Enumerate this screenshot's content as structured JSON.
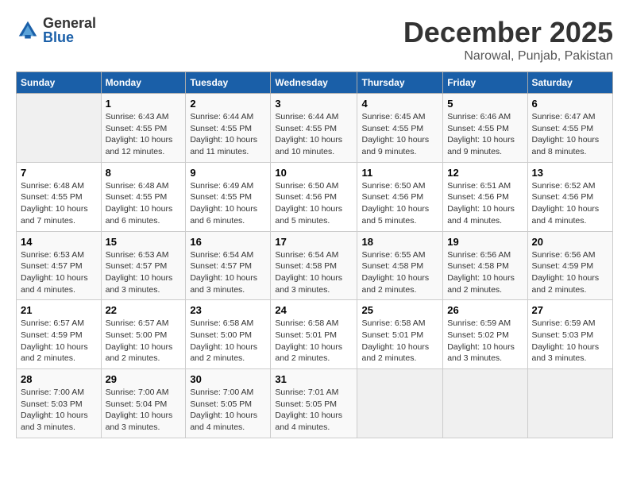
{
  "logo": {
    "general": "General",
    "blue": "Blue"
  },
  "title": "December 2025",
  "subtitle": "Narowal, Punjab, Pakistan",
  "headers": [
    "Sunday",
    "Monday",
    "Tuesday",
    "Wednesday",
    "Thursday",
    "Friday",
    "Saturday"
  ],
  "weeks": [
    [
      {
        "day": "",
        "info": ""
      },
      {
        "day": "1",
        "info": "Sunrise: 6:43 AM\nSunset: 4:55 PM\nDaylight: 10 hours\nand 12 minutes."
      },
      {
        "day": "2",
        "info": "Sunrise: 6:44 AM\nSunset: 4:55 PM\nDaylight: 10 hours\nand 11 minutes."
      },
      {
        "day": "3",
        "info": "Sunrise: 6:44 AM\nSunset: 4:55 PM\nDaylight: 10 hours\nand 10 minutes."
      },
      {
        "day": "4",
        "info": "Sunrise: 6:45 AM\nSunset: 4:55 PM\nDaylight: 10 hours\nand 9 minutes."
      },
      {
        "day": "5",
        "info": "Sunrise: 6:46 AM\nSunset: 4:55 PM\nDaylight: 10 hours\nand 9 minutes."
      },
      {
        "day": "6",
        "info": "Sunrise: 6:47 AM\nSunset: 4:55 PM\nDaylight: 10 hours\nand 8 minutes."
      }
    ],
    [
      {
        "day": "7",
        "info": "Sunrise: 6:48 AM\nSunset: 4:55 PM\nDaylight: 10 hours\nand 7 minutes."
      },
      {
        "day": "8",
        "info": "Sunrise: 6:48 AM\nSunset: 4:55 PM\nDaylight: 10 hours\nand 6 minutes."
      },
      {
        "day": "9",
        "info": "Sunrise: 6:49 AM\nSunset: 4:55 PM\nDaylight: 10 hours\nand 6 minutes."
      },
      {
        "day": "10",
        "info": "Sunrise: 6:50 AM\nSunset: 4:56 PM\nDaylight: 10 hours\nand 5 minutes."
      },
      {
        "day": "11",
        "info": "Sunrise: 6:50 AM\nSunset: 4:56 PM\nDaylight: 10 hours\nand 5 minutes."
      },
      {
        "day": "12",
        "info": "Sunrise: 6:51 AM\nSunset: 4:56 PM\nDaylight: 10 hours\nand 4 minutes."
      },
      {
        "day": "13",
        "info": "Sunrise: 6:52 AM\nSunset: 4:56 PM\nDaylight: 10 hours\nand 4 minutes."
      }
    ],
    [
      {
        "day": "14",
        "info": "Sunrise: 6:53 AM\nSunset: 4:57 PM\nDaylight: 10 hours\nand 4 minutes."
      },
      {
        "day": "15",
        "info": "Sunrise: 6:53 AM\nSunset: 4:57 PM\nDaylight: 10 hours\nand 3 minutes."
      },
      {
        "day": "16",
        "info": "Sunrise: 6:54 AM\nSunset: 4:57 PM\nDaylight: 10 hours\nand 3 minutes."
      },
      {
        "day": "17",
        "info": "Sunrise: 6:54 AM\nSunset: 4:58 PM\nDaylight: 10 hours\nand 3 minutes."
      },
      {
        "day": "18",
        "info": "Sunrise: 6:55 AM\nSunset: 4:58 PM\nDaylight: 10 hours\nand 2 minutes."
      },
      {
        "day": "19",
        "info": "Sunrise: 6:56 AM\nSunset: 4:58 PM\nDaylight: 10 hours\nand 2 minutes."
      },
      {
        "day": "20",
        "info": "Sunrise: 6:56 AM\nSunset: 4:59 PM\nDaylight: 10 hours\nand 2 minutes."
      }
    ],
    [
      {
        "day": "21",
        "info": "Sunrise: 6:57 AM\nSunset: 4:59 PM\nDaylight: 10 hours\nand 2 minutes."
      },
      {
        "day": "22",
        "info": "Sunrise: 6:57 AM\nSunset: 5:00 PM\nDaylight: 10 hours\nand 2 minutes."
      },
      {
        "day": "23",
        "info": "Sunrise: 6:58 AM\nSunset: 5:00 PM\nDaylight: 10 hours\nand 2 minutes."
      },
      {
        "day": "24",
        "info": "Sunrise: 6:58 AM\nSunset: 5:01 PM\nDaylight: 10 hours\nand 2 minutes."
      },
      {
        "day": "25",
        "info": "Sunrise: 6:58 AM\nSunset: 5:01 PM\nDaylight: 10 hours\nand 2 minutes."
      },
      {
        "day": "26",
        "info": "Sunrise: 6:59 AM\nSunset: 5:02 PM\nDaylight: 10 hours\nand 3 minutes."
      },
      {
        "day": "27",
        "info": "Sunrise: 6:59 AM\nSunset: 5:03 PM\nDaylight: 10 hours\nand 3 minutes."
      }
    ],
    [
      {
        "day": "28",
        "info": "Sunrise: 7:00 AM\nSunset: 5:03 PM\nDaylight: 10 hours\nand 3 minutes."
      },
      {
        "day": "29",
        "info": "Sunrise: 7:00 AM\nSunset: 5:04 PM\nDaylight: 10 hours\nand 3 minutes."
      },
      {
        "day": "30",
        "info": "Sunrise: 7:00 AM\nSunset: 5:05 PM\nDaylight: 10 hours\nand 4 minutes."
      },
      {
        "day": "31",
        "info": "Sunrise: 7:01 AM\nSunset: 5:05 PM\nDaylight: 10 hours\nand 4 minutes."
      },
      {
        "day": "",
        "info": ""
      },
      {
        "day": "",
        "info": ""
      },
      {
        "day": "",
        "info": ""
      }
    ]
  ]
}
